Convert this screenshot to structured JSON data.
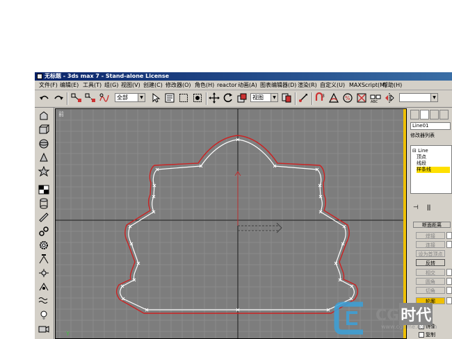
{
  "window": {
    "title": "无标题 - 3ds max 7 - Stand-alone License"
  },
  "menu": [
    "文件(F)",
    "编辑(E)",
    "工具(T)",
    "组(G)",
    "视图(V)",
    "创建(C)",
    "修改器(O)",
    "角色(H)",
    "reactor",
    "动画(A)",
    "图表编辑器(D)",
    "渲染(R)",
    "自定义(U)",
    "MAXScript(M)",
    "帮助(H)"
  ],
  "toolbar": {
    "selection_filter": "全部",
    "reference_coord": "视图"
  },
  "viewport": {
    "label": "前",
    "background": "#7d7d7d",
    "grid_color": "#8c8c8c",
    "axis_color": "#1a1a1a",
    "spline_color": "#ffffff",
    "outline_color": "#cc2222",
    "active_border": "#f0c000"
  },
  "command_panel": {
    "object_name": "Line01",
    "modifier_list": "修改器列表",
    "stack": {
      "root": "Line",
      "items": [
        "顶点",
        "线段",
        "样条线"
      ],
      "selected": "样条线"
    },
    "rollout_title": "断面距离",
    "buttons": [
      "焊接",
      "连接",
      "设为首顶点",
      "反转",
      "相交",
      "圆角",
      "切角",
      "轮廓"
    ],
    "active_buttons": [
      "反转",
      "轮廓"
    ],
    "selected_button": "轮廓",
    "checks": [
      "镜像",
      "复制"
    ]
  },
  "watermark": {
    "brand_latin": "CG",
    "brand_cjk": "时代",
    "url": "www.cgtime.com.cn"
  }
}
